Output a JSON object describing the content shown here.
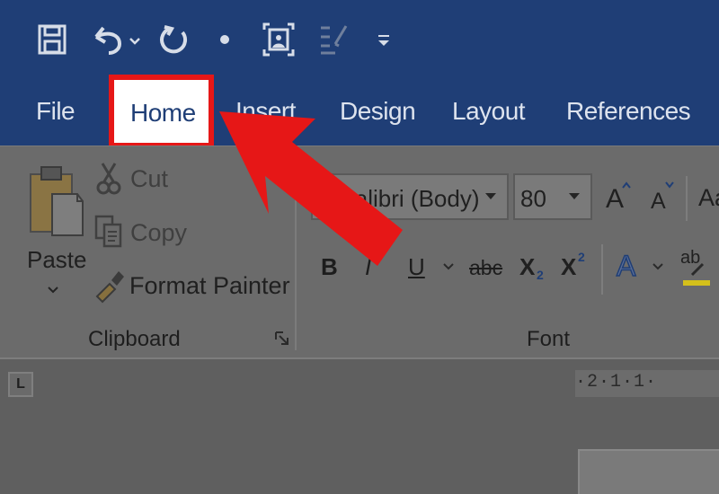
{
  "tabs": {
    "file": "File",
    "home": "Home",
    "insert": "Insert",
    "design": "Design",
    "layout": "Layout",
    "references": "References"
  },
  "clipboard": {
    "paste": "Paste",
    "cut": "Cut",
    "copy": "Copy",
    "format_painter": "Format Painter",
    "group_label": "Clipboard"
  },
  "font": {
    "font_name": "Calibri (Body)",
    "font_size": "80",
    "bold": "B",
    "italic": "I",
    "underline": "U",
    "strikethrough": "abc",
    "subscript_base": "X",
    "subscript_sub": "2",
    "superscript_base": "X",
    "superscript_sup": "2",
    "grow_font": "A",
    "shrink_font": "A",
    "text_effects": "A",
    "highlight": "ab",
    "change_case": "Aa",
    "group_label": "Font"
  },
  "ruler": {
    "corner": "L",
    "marks": "·2·1·1·"
  },
  "colors": {
    "ribbon_blue": "#1f3e76",
    "highlight_red": "#e61717",
    "highlight_yellow": "#d4c01b"
  },
  "icons": [
    "save-icon",
    "undo-icon",
    "redo-icon",
    "touch-mode-icon",
    "customize-icon",
    "paste-icon",
    "cut-icon",
    "copy-icon",
    "format-painter-icon",
    "dialog-launcher-icon",
    "arrow-icon"
  ]
}
